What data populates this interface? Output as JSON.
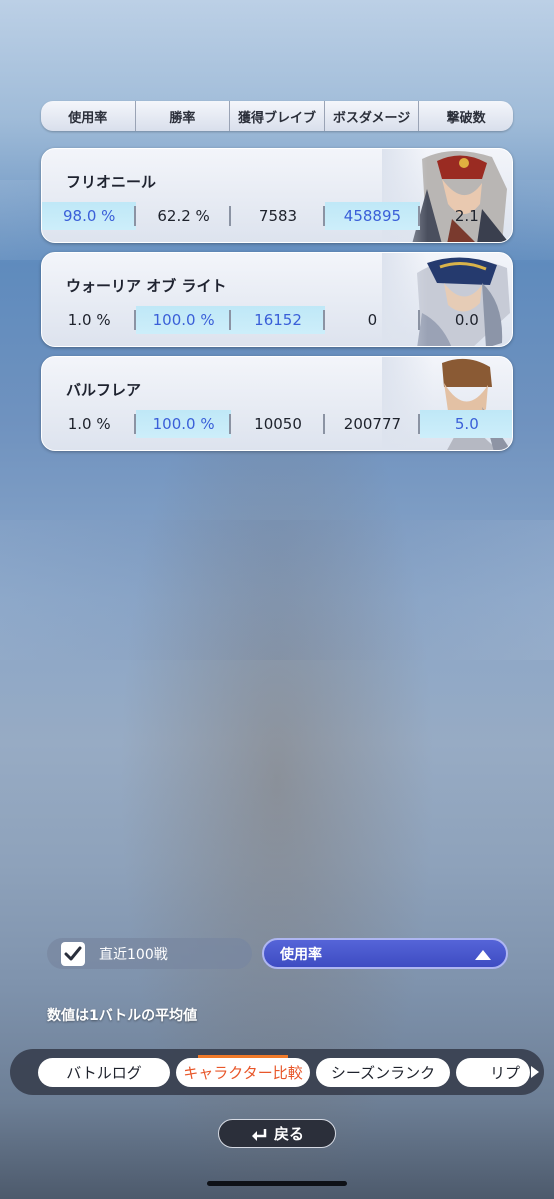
{
  "header": {
    "columns": [
      "使用率",
      "勝率",
      "獲得ブレイブ",
      "ボスダメージ",
      "撃破数"
    ]
  },
  "characters": [
    {
      "name": "フリオニール",
      "values": [
        "98.0 %",
        "62.2 %",
        "7583",
        "458895",
        "2.1"
      ],
      "highlight": [
        true,
        false,
        false,
        true,
        false
      ]
    },
    {
      "name": "ウォーリア オブ ライト",
      "values": [
        "1.0 %",
        "100.0 %",
        "16152",
        "0",
        "0.0"
      ],
      "highlight": [
        false,
        true,
        true,
        false,
        false
      ]
    },
    {
      "name": "バルフレア",
      "values": [
        "1.0 %",
        "100.0 %",
        "10050",
        "200777",
        "5.0"
      ],
      "highlight": [
        false,
        true,
        false,
        false,
        true
      ]
    }
  ],
  "controls": {
    "recent_toggle_label": "直近100戦",
    "recent_toggle_checked": true,
    "sort_label": "使用率"
  },
  "note": "数値は1バトルの平均値",
  "tabs": [
    "バトルログ",
    "キャラクター比較",
    "シーズンランク",
    "リプ"
  ],
  "active_tab": 1,
  "back_label": "戻る",
  "colors": {
    "highlight_text": "#3a5fd8",
    "highlight_bg": "#c6ebf8",
    "active_tab_text": "#e8572a",
    "sort_button": "#4a58cf"
  }
}
